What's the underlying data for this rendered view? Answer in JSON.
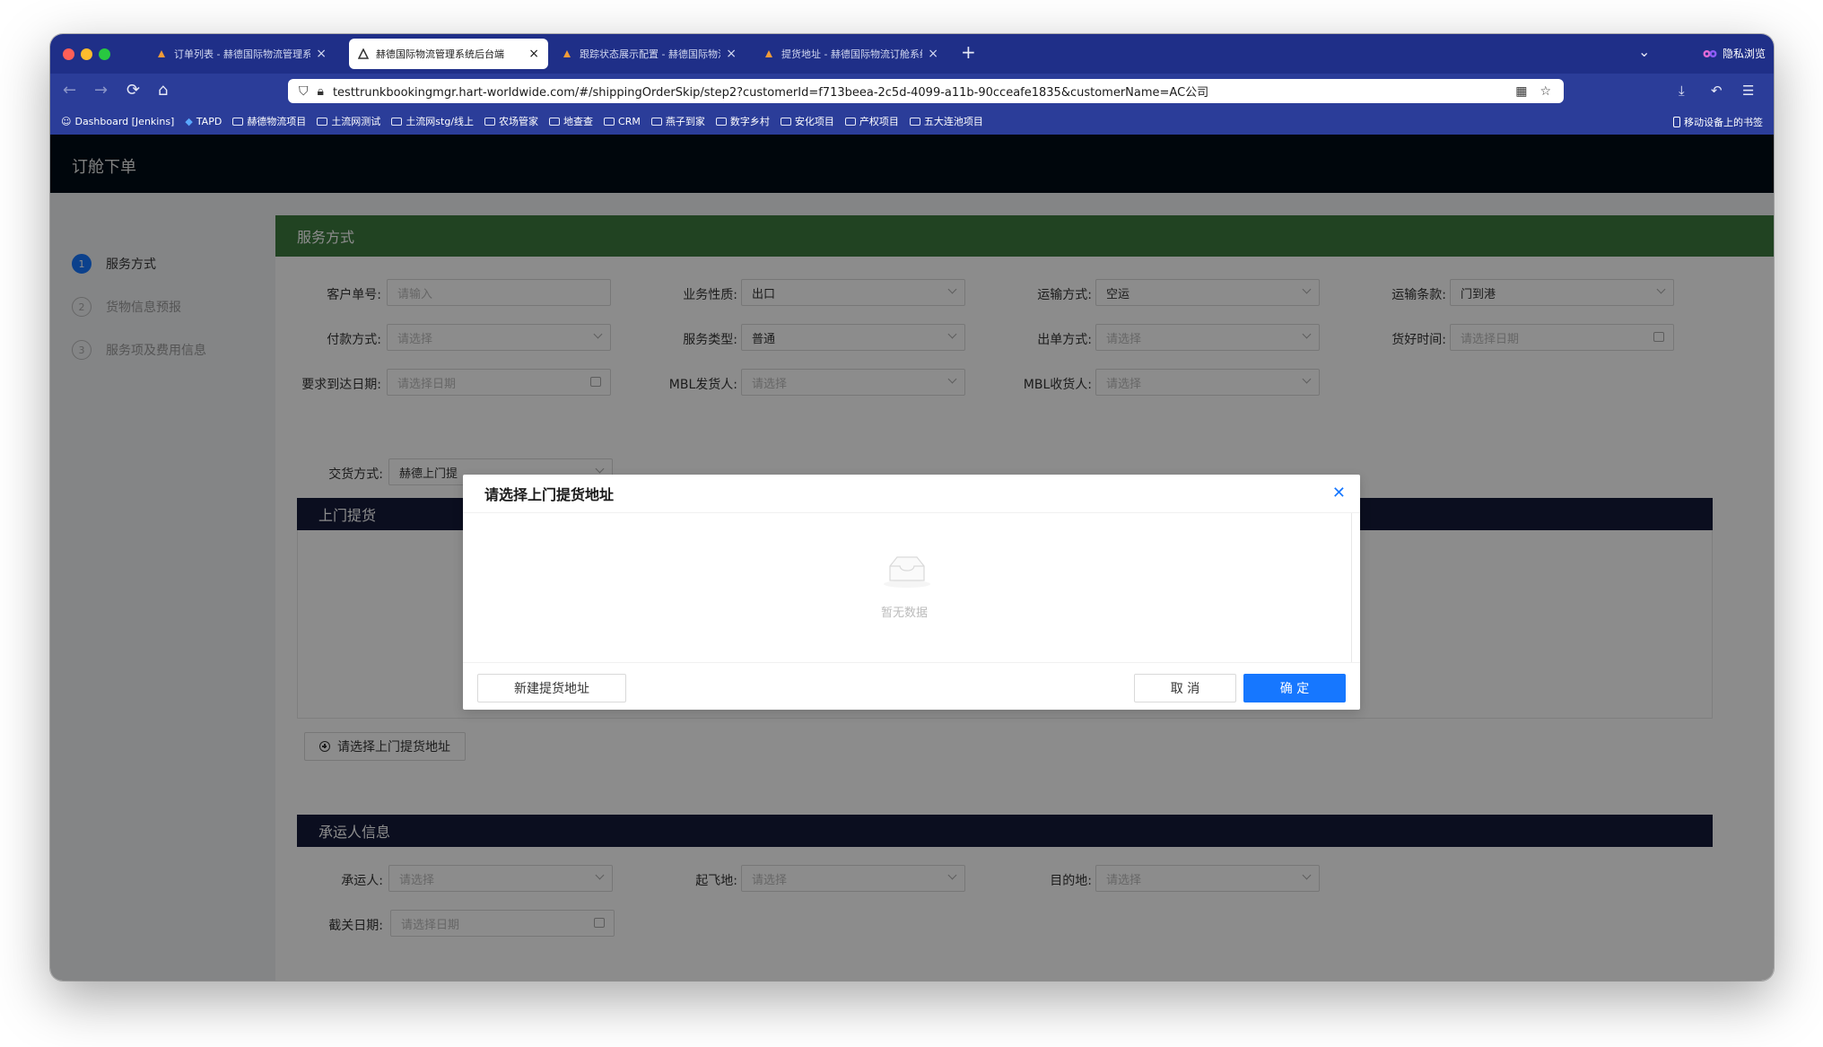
{
  "browser": {
    "tabs": [
      {
        "title": "订单列表 - 赫德国际物流管理系统",
        "active": false
      },
      {
        "title": "赫德国际物流管理系统后台端",
        "active": true
      },
      {
        "title": "跟踪状态展示配置 - 赫德国际物流",
        "active": false
      },
      {
        "title": "提货地址 - 赫德国际物流订舱系统",
        "active": false
      }
    ],
    "private_label": "隐私浏览",
    "url": "testtrunkbookingmgr.hart-worldwide.com/#/shippingOrderSkip/step2?customerId=f713beea-2c5d-4099-a11b-90cceafe1835&customerName=AC公司",
    "bookmarks": [
      "Dashboard [Jenkins]",
      "TAPD",
      "赫德物流项目",
      "土流网测试",
      "土流网stg/线上",
      "农场管家",
      "地查查",
      "CRM",
      "燕子到家",
      "数字乡村",
      "安化项目",
      "产权项目",
      "五大连池项目"
    ],
    "mobile_bookmarks": "移动设备上的书签"
  },
  "page": {
    "title": "订舱下单",
    "steps": [
      {
        "num": "1",
        "label": "服务方式",
        "active": true
      },
      {
        "num": "2",
        "label": "货物信息预报",
        "active": false
      },
      {
        "num": "3",
        "label": "服务项及费用信息",
        "active": false
      }
    ],
    "section_title": "服务方式",
    "form": {
      "customer_no": {
        "label": "客户单号:",
        "placeholder": "请输入"
      },
      "business_nature": {
        "label": "业务性质:",
        "value": "出口"
      },
      "transport_mode": {
        "label": "运输方式:",
        "value": "空运"
      },
      "transport_terms": {
        "label": "运输条款:",
        "value": "门到港"
      },
      "payment_method": {
        "label": "付款方式:",
        "placeholder": "请选择"
      },
      "service_type": {
        "label": "服务类型:",
        "value": "普通"
      },
      "billing_method": {
        "label": "出单方式:",
        "placeholder": "请选择"
      },
      "cargo_ready_time": {
        "label": "货好时间:",
        "placeholder": "请选择日期"
      },
      "required_arrival": {
        "label": "要求到达日期:",
        "placeholder": "请选择日期"
      },
      "mbl_shipper": {
        "label": "MBL发货人:",
        "placeholder": "请选择"
      },
      "mbl_consignee": {
        "label": "MBL收货人:",
        "placeholder": "请选择"
      },
      "delivery_method": {
        "label": "交货方式:",
        "value": "赫德上门提"
      }
    },
    "pickup_title": "上门提货",
    "select_pickup_button": "请选择上门提货地址",
    "carrier_title": "承运人信息",
    "carrier_form": {
      "carrier": {
        "label": "承运人:",
        "placeholder": "请选择"
      },
      "departure": {
        "label": "起飞地:",
        "placeholder": "请选择"
      },
      "destination": {
        "label": "目的地:",
        "placeholder": "请选择"
      },
      "cutoff_date": {
        "label": "截关日期:",
        "placeholder": "请选择日期"
      }
    }
  },
  "modal": {
    "title": "请选择上门提货地址",
    "empty_text": "暂无数据",
    "new_address_button": "新建提货地址",
    "cancel_button": "取 消",
    "ok_button": "确 定"
  }
}
